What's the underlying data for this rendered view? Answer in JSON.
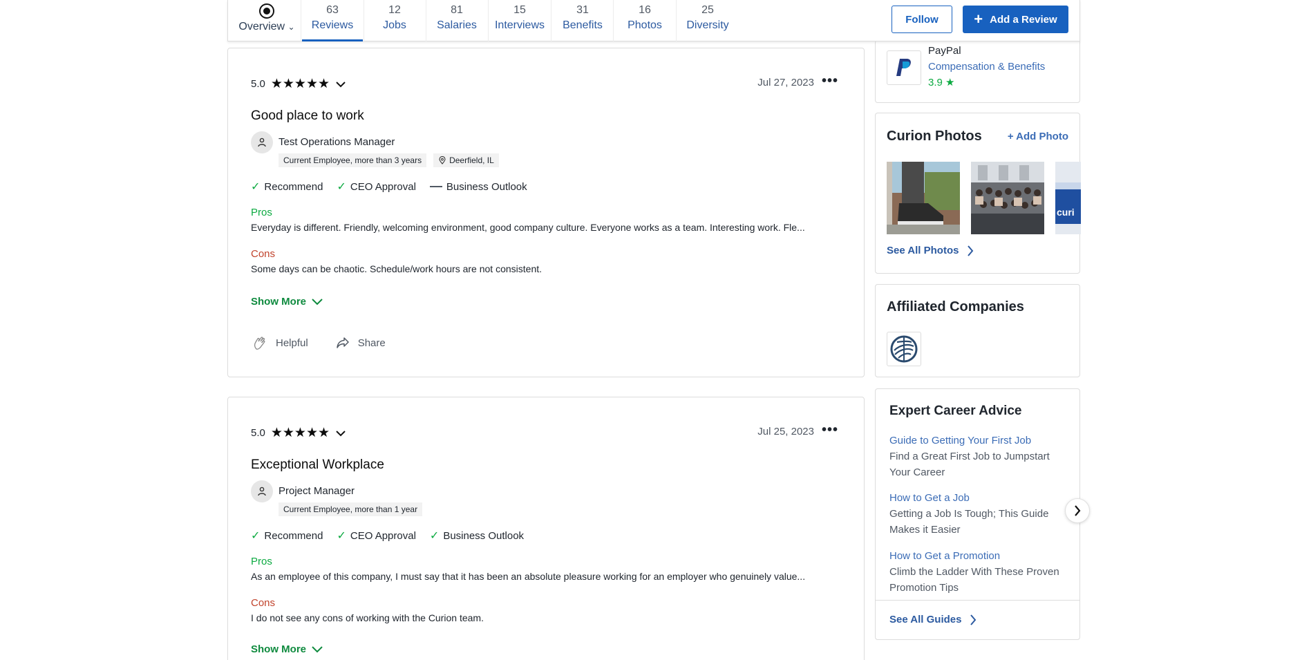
{
  "nav": {
    "tabs": [
      {
        "num": "",
        "label": "Overview"
      },
      {
        "num": "63",
        "label": "Reviews"
      },
      {
        "num": "12",
        "label": "Jobs"
      },
      {
        "num": "81",
        "label": "Salaries"
      },
      {
        "num": "15",
        "label": "Interviews"
      },
      {
        "num": "31",
        "label": "Benefits"
      },
      {
        "num": "16",
        "label": "Photos"
      },
      {
        "num": "25",
        "label": "Diversity"
      }
    ],
    "follow_label": "Follow",
    "add_review_label": "Add a Review"
  },
  "reviews": [
    {
      "rating": "5.0",
      "stars": "★★★★★",
      "date": "Jul 27, 2023",
      "title": "Good place to work",
      "job": "Test Operations Manager",
      "status": "Current Employee, more than 3 years",
      "location": "Deerfield, IL",
      "indicators": [
        {
          "label": "Recommend",
          "icon": "check"
        },
        {
          "label": "CEO Approval",
          "icon": "check"
        },
        {
          "label": "Business Outlook",
          "icon": "dash"
        }
      ],
      "pros_label": "Pros",
      "pros": "Everyday is different. Friendly, welcoming environment, good company culture. Everyone works as a team. Interesting work. Fle...",
      "cons_label": "Cons",
      "cons": "Some days can be chaotic. Schedule/work hours are not consistent.",
      "show_more": "Show More",
      "helpful": "Helpful",
      "share": "Share"
    },
    {
      "rating": "5.0",
      "stars": "★★★★★",
      "date": "Jul 25, 2023",
      "title": "Exceptional Workplace",
      "job": "Project Manager",
      "status": "Current Employee, more than 1 year",
      "indicators": [
        {
          "label": "Recommend",
          "icon": "check"
        },
        {
          "label": "CEO Approval",
          "icon": "check"
        },
        {
          "label": "Business Outlook",
          "icon": "check"
        }
      ],
      "pros_label": "Pros",
      "pros": "As an employee of this company, I must say that it has been an absolute pleasure working for an employer who genuinely value...",
      "cons_label": "Cons",
      "cons": "I do not see any cons of working with the Curion team.",
      "show_more": "Show More"
    }
  ],
  "sidebar": {
    "paypal": {
      "name": "PayPal",
      "category": "Compensation & Benefits",
      "rating": "3.9 ★"
    },
    "photos": {
      "title": "Curion Photos",
      "add_label": "+ Add Photo",
      "see_all": "See All Photos"
    },
    "affiliated": {
      "title": "Affiliated Companies"
    },
    "advice": {
      "title": "Expert Career Advice",
      "items": [
        {
          "link": "Guide to Getting Your First Job",
          "desc": "Find a Great First Job to Jumpstart Your Career"
        },
        {
          "link": "How to Get a Job",
          "desc": "Getting a Job Is Tough; This Guide Makes it Easier"
        },
        {
          "link": "How to Get a Promotion",
          "desc": "Climb the Ladder With These Proven Promotion Tips"
        }
      ],
      "see_all": "See All Guides"
    }
  },
  "colors": {
    "brand_blue": "#1861bf",
    "green": "#0caa41",
    "cons_red": "#c1432c"
  }
}
